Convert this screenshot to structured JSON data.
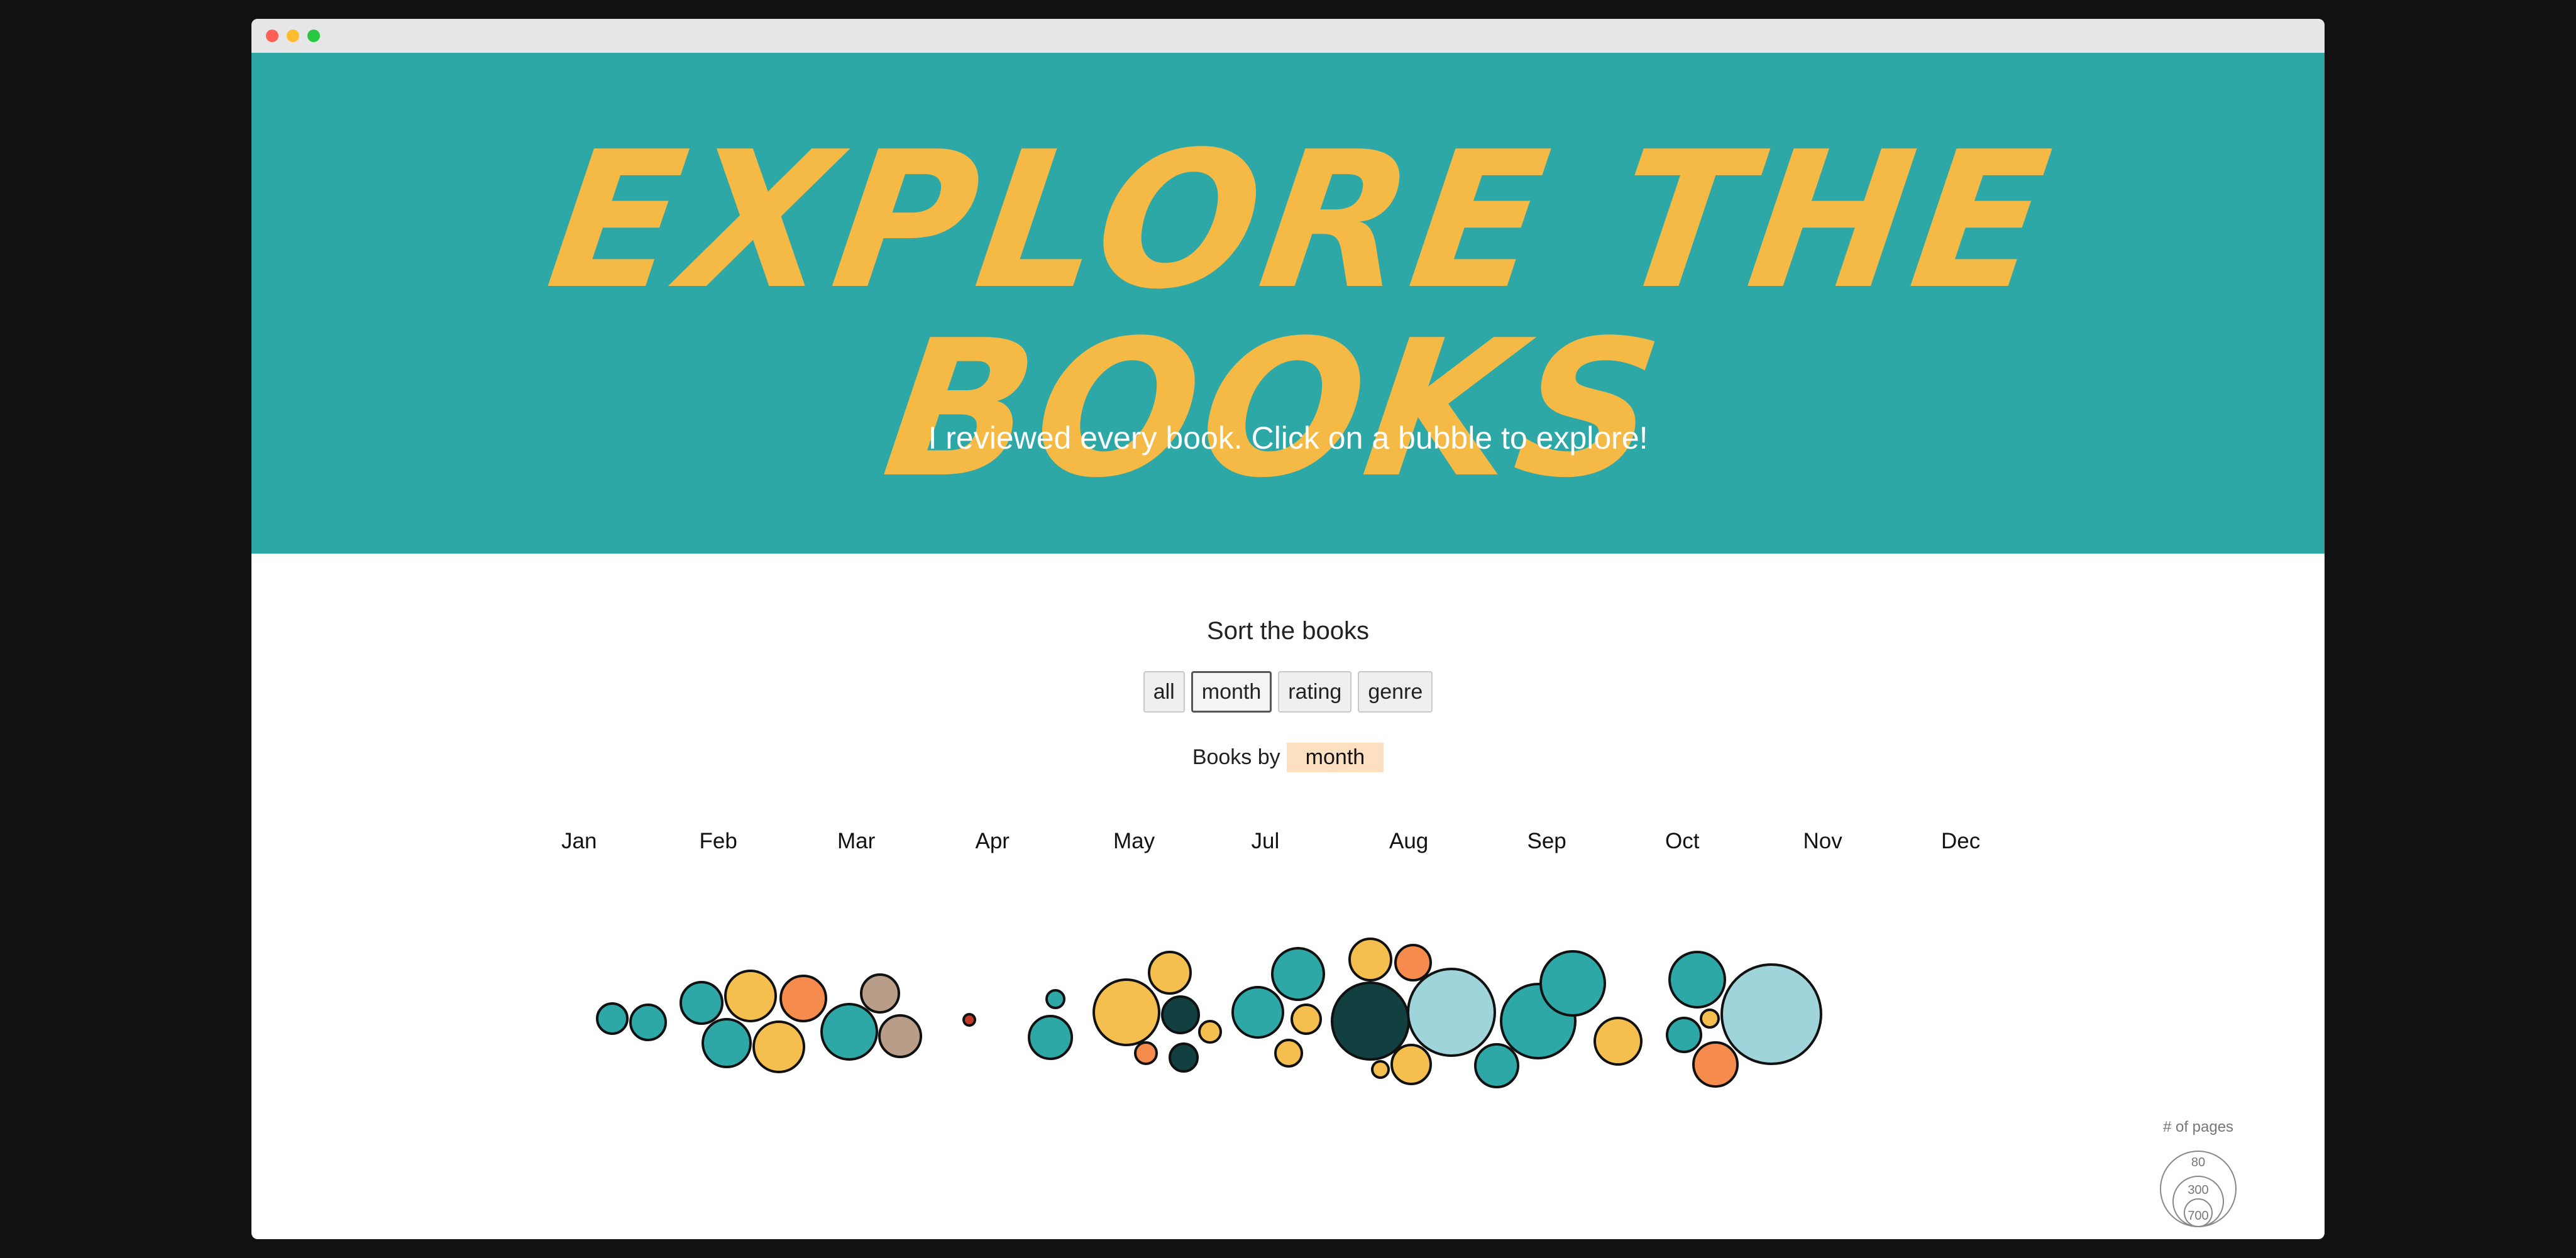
{
  "window": {
    "controls": [
      "close",
      "minimize",
      "maximize"
    ]
  },
  "hero": {
    "title": "EXPLORE THE BOOKS",
    "subtitle": "I reviewed every book. Click on a bubble to explore!",
    "background_color": "#2ea8a7",
    "title_color": "#f5b945"
  },
  "sort": {
    "heading": "Sort the books",
    "buttons": [
      {
        "label": "all",
        "active": false
      },
      {
        "label": "month",
        "active": true
      },
      {
        "label": "rating",
        "active": false
      },
      {
        "label": "genre",
        "active": false
      }
    ]
  },
  "books_by": {
    "prefix": "Books by",
    "value": "month",
    "pill_color": "#fde0c2"
  },
  "chart_data": {
    "type": "scatter",
    "encoding": "bubble area = # of pages, bubble color = category",
    "categories": [
      "Jan",
      "Feb",
      "Mar",
      "Apr",
      "May",
      "Jul",
      "Aug",
      "Sep",
      "Oct",
      "Nov",
      "Dec"
    ],
    "colors": {
      "teal": "#2ea8a7",
      "yellow": "#f4bf4f",
      "orange": "#f58b4c",
      "tan": "#b89d88",
      "dark": "#123f40",
      "light": "#9ed4da",
      "red": "#c0392b"
    },
    "size_legend": {
      "title": "# of pages",
      "values": [
        80,
        300,
        700
      ]
    }
  }
}
